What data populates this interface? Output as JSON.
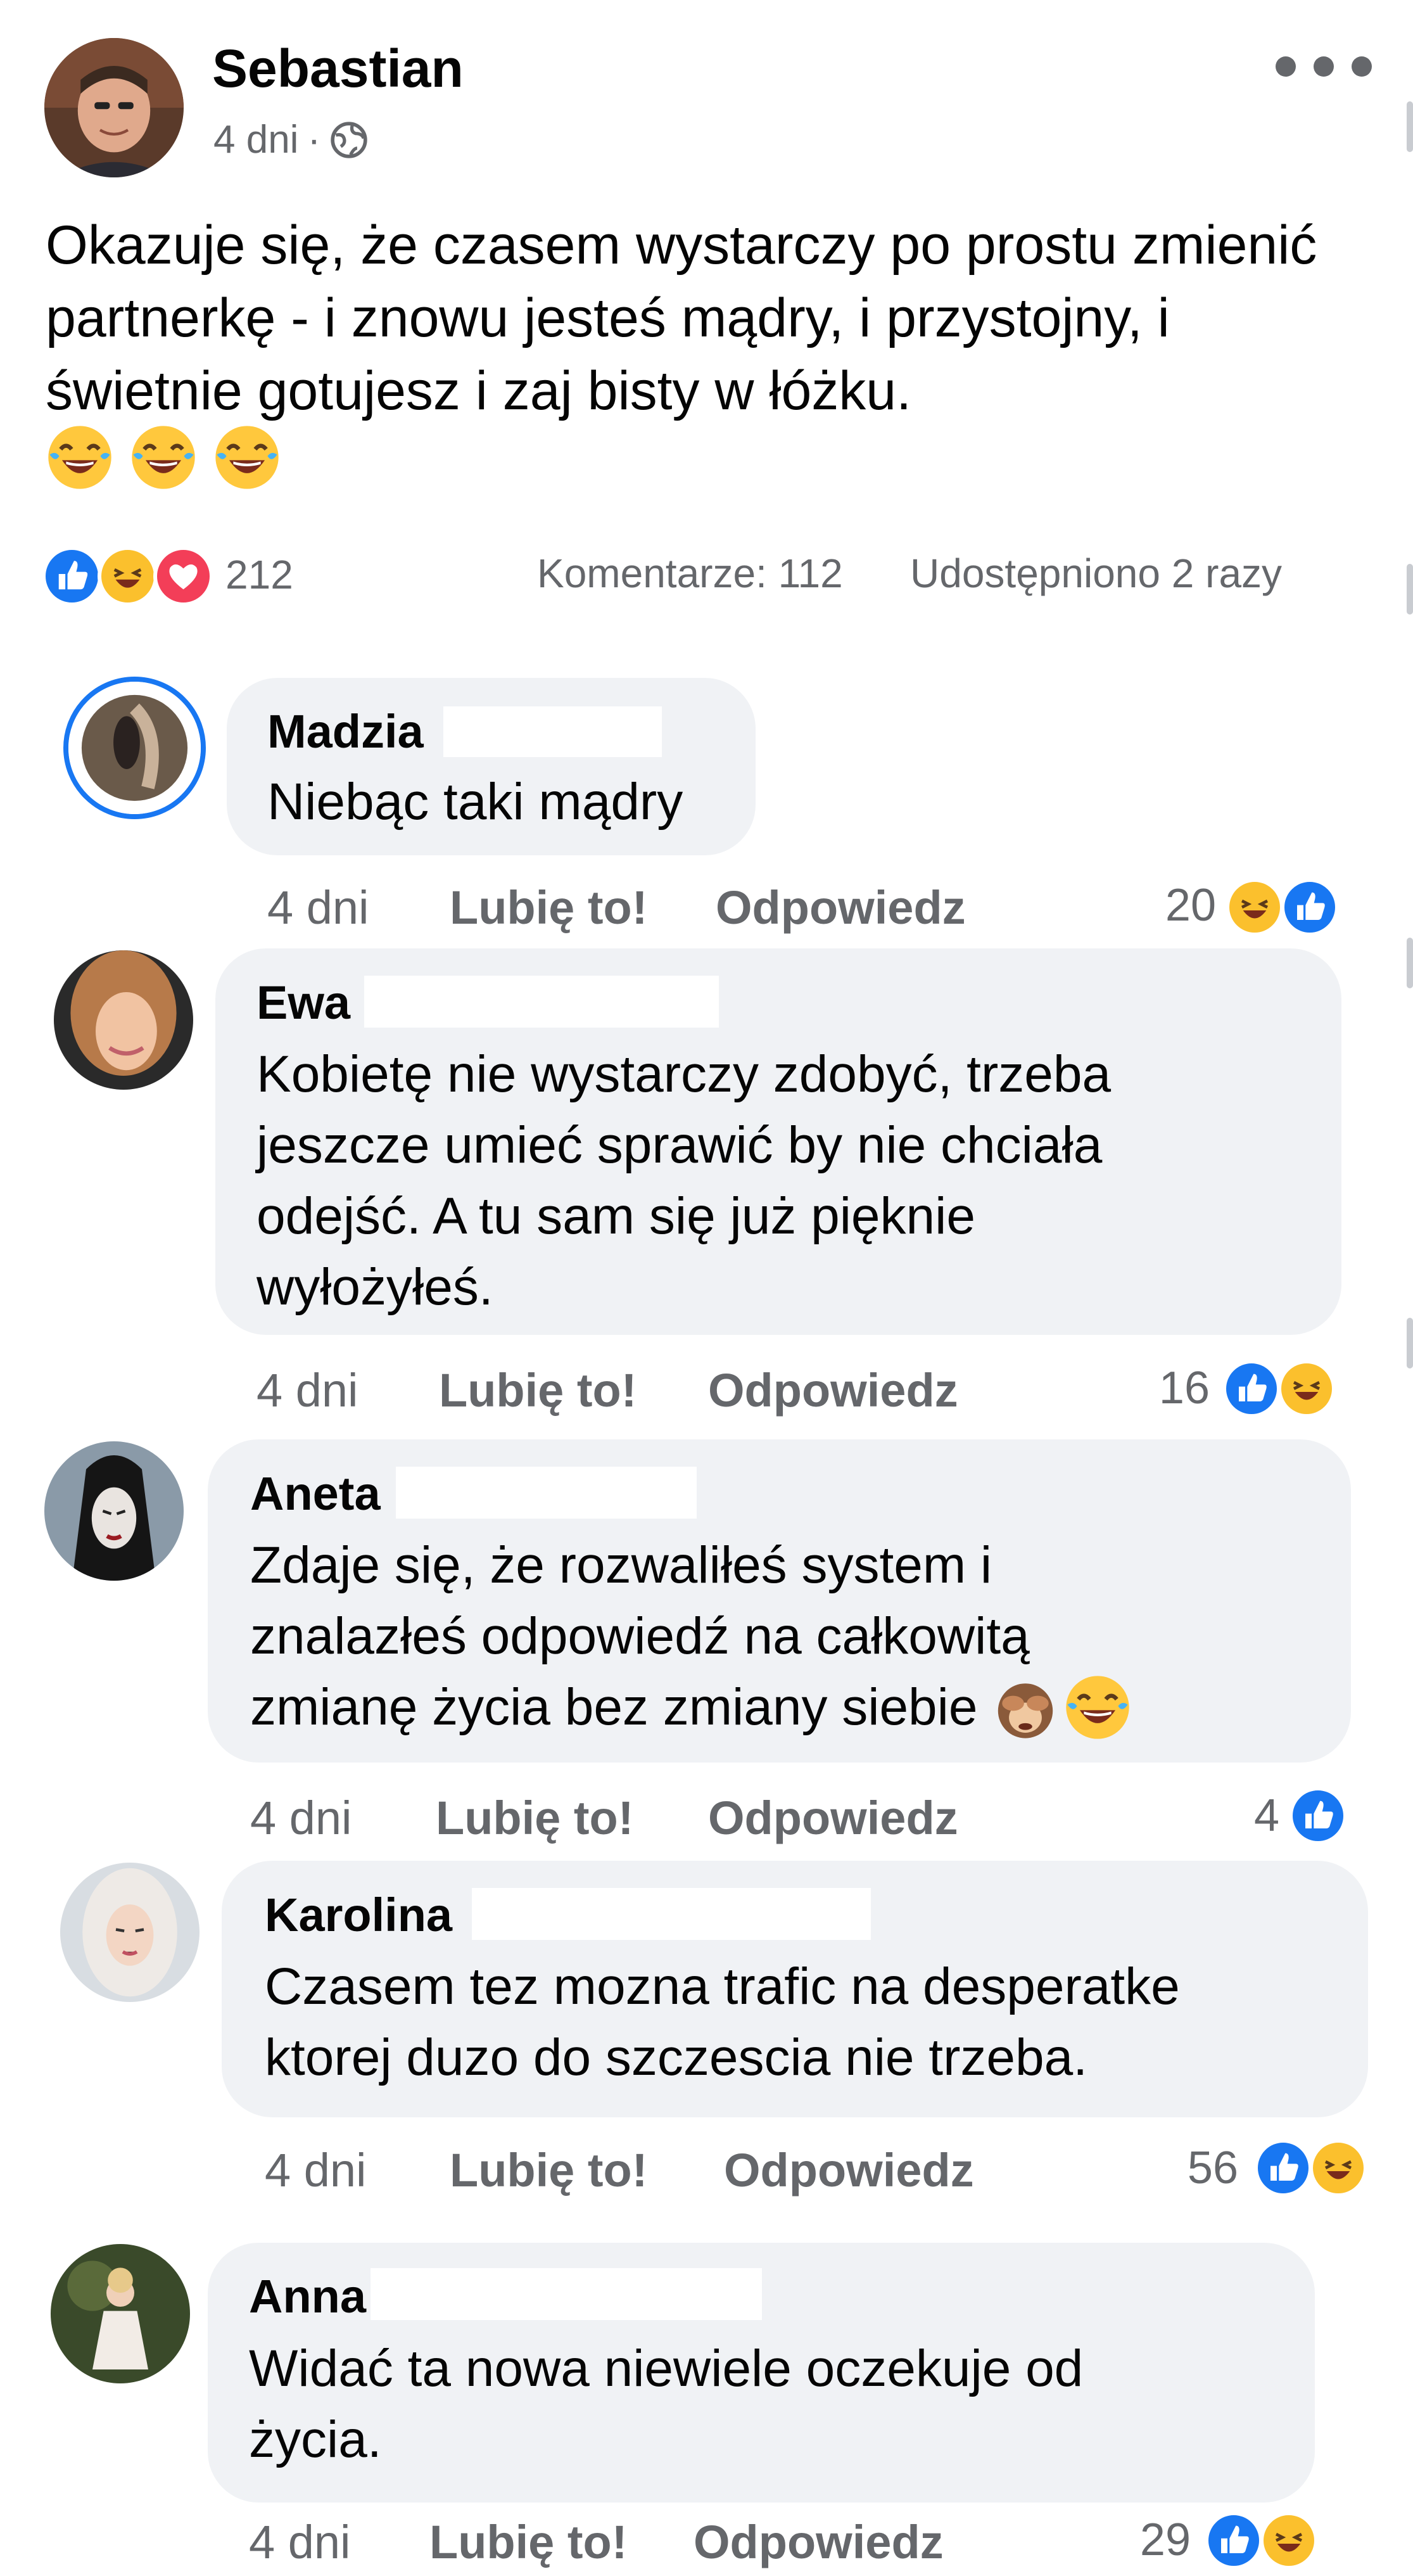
{
  "post": {
    "author": "Sebastian",
    "time": "4 dni",
    "separator": "·",
    "text": "Okazuje się, że czasem wystarczy po prostu zmienić partnerkę - i znowu jesteś mądry, i przystojny, i świetnie gotujesz i zaj  bisty w łóżku.",
    "emojis": [
      "laughing-tears-emoji",
      "laughing-tears-emoji",
      "laughing-tears-emoji"
    ],
    "more_icon": "more-dots-icon",
    "audience_icon": "globe-icon"
  },
  "stats": {
    "reactions_count": "212",
    "comments": "Komentarze: 112",
    "shares": "Udostępniono 2 razy"
  },
  "labels": {
    "like": "Lubię to!",
    "reply": "Odpowiedz"
  },
  "colors": {
    "like_blue": "#1877f2",
    "haha_yellow": "#fbc02d",
    "love_red": "#f33e58",
    "bubble_gray": "#f0f2f5",
    "meta_gray": "#65676b"
  },
  "comments": [
    {
      "name": "Madzia",
      "lines": [
        "Niebąc taki mądry"
      ],
      "time": "4 dni",
      "count": "20",
      "reactions": [
        "haha",
        "like"
      ]
    },
    {
      "name": "Ewa",
      "lines": [
        "Kobietę nie wystarczy zdobyć, trzeba",
        "jeszcze umieć sprawić by nie chciała",
        "odejść. A tu sam się już pięknie",
        "wyłożyłeś."
      ],
      "time": "4 dni",
      "count": "16",
      "reactions": [
        "like",
        "haha"
      ]
    },
    {
      "name": "Aneta",
      "lines": [
        "Zdaje się, że rozwaliłeś system i",
        "znalazłeś odpowiedź na całkowitą",
        "zmianę życia bez zmiany siebie"
      ],
      "time": "4 dni",
      "count": "4",
      "reactions": [
        "like"
      ],
      "emojis": [
        "see-no-evil-monkey-emoji",
        "laughing-tears-emoji"
      ]
    },
    {
      "name": "Karolina",
      "lines": [
        "Czasem tez mozna trafic na desperatke",
        "ktorej duzo do szczescia nie trzeba."
      ],
      "time": "4 dni",
      "count": "56",
      "reactions": [
        "like",
        "haha"
      ]
    },
    {
      "name": "Anna",
      "lines": [
        "Widać ta nowa niewiele oczekuje od",
        "życia."
      ],
      "time": "4 dni",
      "count": "29",
      "reactions": [
        "like",
        "haha"
      ]
    }
  ]
}
